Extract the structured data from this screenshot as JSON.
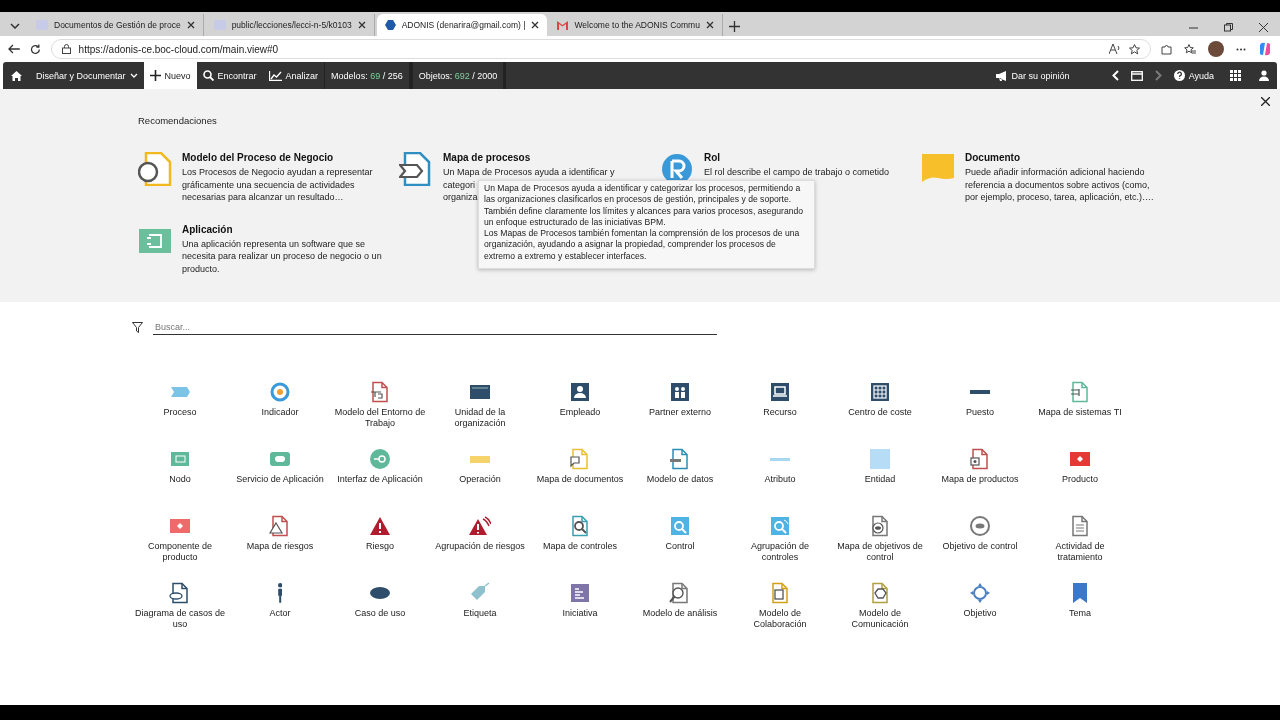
{
  "browser_tabs": [
    {
      "title": "Documentos de Gestión de proce",
      "selected": false,
      "kind": "td"
    },
    {
      "title": "public/lecciones/lecci-n-5/k0103",
      "selected": false,
      "kind": "td"
    },
    {
      "title": "ADONIS (denarira@gmail.com) |",
      "selected": true,
      "kind": "adonis"
    },
    {
      "title": "Welcome to the ADONIS Commu",
      "selected": false,
      "kind": "mail"
    }
  ],
  "address_bar": {
    "url": "https://adonis-ce.boc-cloud.com/main.view#0"
  },
  "navbar": {
    "menu": "Diseñar y Documentar",
    "actions": [
      {
        "label": "Nuevo",
        "selected": true
      },
      {
        "label": "Encontrar",
        "selected": false
      },
      {
        "label": "Analizar",
        "selected": false
      }
    ],
    "counters": [
      {
        "label": "Modelos:",
        "used": "69",
        "limit": "/ 256"
      },
      {
        "label": "Objetos:",
        "used": "692",
        "limit": "/ 2000"
      }
    ],
    "feedback": "Dar su opinión",
    "forward_disabled": true,
    "help": "Ayuda"
  },
  "recommendations": {
    "title": "Recomendaciones",
    "cards": [
      {
        "title": "Modelo del Proceso de Negocio",
        "description": "Los Procesos de Negocio ayudan a representar gráficamente una secuencia de actividades necesarias para alcanzar un resultado…"
      },
      {
        "title": "Mapa de procesos",
        "lines": [
          "Un Mapa de Procesos ayuda a identificar y",
          "categori",
          "organiza"
        ]
      },
      {
        "title": "Rol",
        "description": "El rol describe el campo de trabajo o cometido"
      },
      {
        "title": "Documento",
        "description": "Puede añadir información adicional haciendo referencia a documentos sobre activos (como, por ejemplo, proceso, tarea, aplicación, etc.)…."
      },
      {
        "title": "Aplicación",
        "description": "Una aplicación representa un software que se necesita para realizar un proceso de negocio o un producto."
      }
    ],
    "tooltip": [
      "Un Mapa de Procesos ayuda a identificar y categorizar los procesos, permitiendo a las organizaciones clasificarlos en procesos de gestión, principales y de soporte. También define claramente los límites y alcances para varios procesos, asegurando un enfoque estructurado de las iniciativas BPM.",
      "Los Mapas de Procesos también fomentan la comprensión de los procesos de una organización, ayudando a asignar la propiedad, comprender los procesos de extremo a extremo y establecer interfaces."
    ]
  },
  "search": {
    "placeholder": "Buscar..."
  },
  "object_types": [
    {
      "label": "Proceso"
    },
    {
      "label": "Indicador"
    },
    {
      "label": "Modelo del Entorno de Trabajo"
    },
    {
      "label": "Unidad de la organización"
    },
    {
      "label": "Empleado"
    },
    {
      "label": "Partner externo"
    },
    {
      "label": "Recurso"
    },
    {
      "label": "Centro de coste"
    },
    {
      "label": "Puesto"
    },
    {
      "label": "Mapa de sistemas TI"
    },
    {
      "label": "Nodo"
    },
    {
      "label": "Servicio de Aplicación"
    },
    {
      "label": "Interfaz de Aplicación"
    },
    {
      "label": "Operación"
    },
    {
      "label": "Mapa de documentos"
    },
    {
      "label": "Modelo de datos"
    },
    {
      "label": "Atributo"
    },
    {
      "label": "Entidad"
    },
    {
      "label": "Mapa de productos"
    },
    {
      "label": "Producto"
    },
    {
      "label": "Componente de producto"
    },
    {
      "label": "Mapa de riesgos"
    },
    {
      "label": "Riesgo"
    },
    {
      "label": "Agrupación de riesgos"
    },
    {
      "label": "Mapa de controles"
    },
    {
      "label": "Control"
    },
    {
      "label": "Agrupación de controles"
    },
    {
      "label": "Mapa de objetivos de control"
    },
    {
      "label": "Objetivo de control"
    },
    {
      "label": "Actividad de tratamiento"
    },
    {
      "label": "Diagrama de casos de uso"
    },
    {
      "label": "Actor"
    },
    {
      "label": "Caso de uso"
    },
    {
      "label": "Etiqueta"
    },
    {
      "label": "Iniciativa"
    },
    {
      "label": "Modelo de análisis"
    },
    {
      "label": "Modelo de Colaboración"
    },
    {
      "label": "Modelo de Comunicación"
    },
    {
      "label": "Objetivo"
    },
    {
      "label": "Tema"
    }
  ]
}
